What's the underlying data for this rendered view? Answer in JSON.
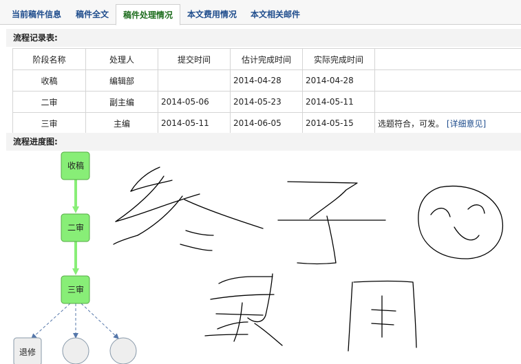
{
  "tabs": [
    {
      "label": "当前稿件信息",
      "active": false
    },
    {
      "label": "稿件全文",
      "active": false
    },
    {
      "label": "稿件处理情况",
      "active": true
    },
    {
      "label": "本文费用情况",
      "active": false
    },
    {
      "label": "本文相关邮件",
      "active": false
    }
  ],
  "record_section": {
    "title": "流程记录表:",
    "columns": [
      "阶段名称",
      "处理人",
      "提交时间",
      "估计完成时间",
      "实际完成时间",
      ""
    ],
    "rows": [
      {
        "stage": "收稿",
        "handler": "编辑部",
        "submitted": "",
        "estimated": "2014-04-28",
        "actual": "2014-04-28",
        "note": "",
        "link": ""
      },
      {
        "stage": "二审",
        "handler": "副主编",
        "submitted": "2014-05-06",
        "estimated": "2014-05-23",
        "actual": "2014-05-11",
        "note": "",
        "link": ""
      },
      {
        "stage": "三审",
        "handler": "主编",
        "submitted": "2014-05-11",
        "estimated": "2014-06-05",
        "actual": "2014-05-15",
        "note": "选题符合，可发。",
        "link": "[详细意见]"
      }
    ]
  },
  "progress_section": {
    "title": "流程进度图:",
    "nodes": [
      "收稿",
      "二审",
      "三审"
    ],
    "branch_nodes": [
      "退修",
      "",
      ""
    ]
  },
  "colors": {
    "tab_text": "#1e4c8c",
    "tab_active_text": "#1e6d1e",
    "node_fill": "#88ee77",
    "node_stroke": "#55aa44",
    "arrow_green": "#88ee77",
    "arrow_blue": "#5577aa"
  }
}
